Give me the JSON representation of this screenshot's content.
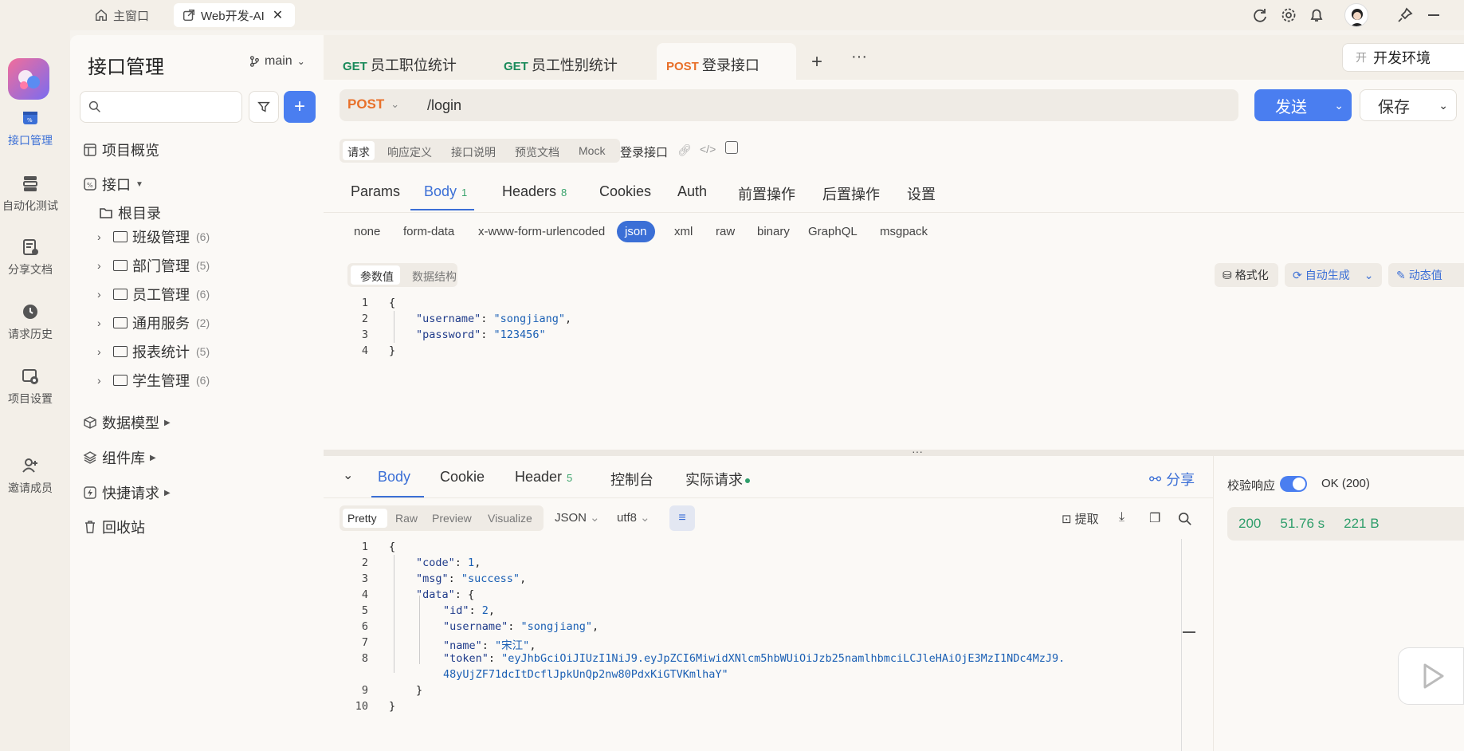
{
  "titlebar": {
    "tabs": [
      {
        "label": "主窗口",
        "icon": "home-icon"
      },
      {
        "label": "Web开发-AI",
        "icon": "external-link-icon"
      }
    ]
  },
  "rail": [
    {
      "label": "接口管理",
      "icon": "api-icon",
      "active": true
    },
    {
      "label": "自动化测试",
      "icon": "stack-icon"
    },
    {
      "label": "分享文档",
      "icon": "doc-share-icon"
    },
    {
      "label": "请求历史",
      "icon": "history-icon"
    },
    {
      "label": "项目设置",
      "icon": "project-settings-icon"
    },
    {
      "label": "邀请成员",
      "icon": "add-user-icon"
    }
  ],
  "sidebar": {
    "title": "接口管理",
    "branch": "main",
    "search_placeholder": "",
    "nav": {
      "overview": "项目概览",
      "api": "接口",
      "root": "根目录",
      "data_model": "数据模型",
      "components": "组件库",
      "quick_request": "快捷请求",
      "recycle": "回收站"
    },
    "folders": [
      {
        "name": "班级管理",
        "count": "(6)"
      },
      {
        "name": "部门管理",
        "count": "(5)"
      },
      {
        "name": "员工管理",
        "count": "(6)"
      },
      {
        "name": "通用服务",
        "count": "(2)"
      },
      {
        "name": "报表统计",
        "count": "(5)"
      },
      {
        "name": "学生管理",
        "count": "(6)"
      }
    ]
  },
  "request_tabs": [
    {
      "method": "GET",
      "name": "员工职位统计"
    },
    {
      "method": "GET",
      "name": "员工性别统计"
    },
    {
      "method": "POST",
      "name": "登录接口",
      "active": true
    }
  ],
  "environment": {
    "badge": "开",
    "label": "开发环境"
  },
  "urlbar": {
    "method": "POST",
    "path": "/login",
    "send": "发送",
    "save": "保存"
  },
  "subtabs": [
    "请求",
    "响应定义",
    "接口说明",
    "预览文档",
    "Mock"
  ],
  "api_name": "登录接口",
  "param_tabs": [
    {
      "label": "Params"
    },
    {
      "label": "Body",
      "count": "1",
      "active": true
    },
    {
      "label": "Headers",
      "count": "8"
    },
    {
      "label": "Cookies"
    },
    {
      "label": "Auth"
    },
    {
      "label": "前置操作"
    },
    {
      "label": "后置操作"
    },
    {
      "label": "设置"
    }
  ],
  "body_types": [
    "none",
    "form-data",
    "x-www-form-urlencoded",
    "json",
    "xml",
    "raw",
    "binary",
    "GraphQL",
    "msgpack"
  ],
  "body_type_selected": "json",
  "editor_tabs": {
    "values": "参数值",
    "schema": "数据结构"
  },
  "editor_actions": {
    "format": "格式化",
    "auto_generate": "自动生成",
    "dynamic": "动态值"
  },
  "request_body": {
    "lines": [
      "1",
      "2",
      "3",
      "4"
    ],
    "username_key": "\"username\"",
    "username_val": "\"songjiang\"",
    "password_key": "\"password\"",
    "password_val": "\"123456\""
  },
  "response_tabs": [
    {
      "label": "Body",
      "active": true
    },
    {
      "label": "Cookie"
    },
    {
      "label": "Header",
      "count": "5"
    },
    {
      "label": "控制台"
    },
    {
      "label": "实际请求"
    }
  ],
  "share": "分享",
  "view_modes": [
    "Pretty",
    "Raw",
    "Preview",
    "Visualize"
  ],
  "format": "JSON",
  "encoding": "utf8",
  "extract": "提取",
  "response_body": {
    "lines": [
      "1",
      "2",
      "3",
      "4",
      "5",
      "6",
      "7",
      "8",
      "9",
      "10"
    ],
    "code_val": "1",
    "msg_val": "\"success\"",
    "id_val": "2",
    "username_val": "\"songjiang\"",
    "name_val": "\"宋江\"",
    "token_val_1": "\"eyJhbGciOiJIUzI1NiJ9.eyJpZCI6MiwidXNlcm5hbWUiOiJzb25namlhbmciLCJleHAiOjE3MzI1NDc4MzJ9.",
    "token_val_2": "48yUjZF71dcItDcflJpkUnQp2nw80PdxKiGTVKmlhaY\""
  },
  "validation": {
    "label": "校验响应",
    "toggle_on": true,
    "result": "OK (200)"
  },
  "stats": {
    "status": "200",
    "time": "51.76 s",
    "size": "221 B"
  },
  "colors": {
    "accent": "#3b6fd6",
    "post": "#e8702a",
    "get": "#1a8a5a",
    "success": "#2f9e6b"
  }
}
